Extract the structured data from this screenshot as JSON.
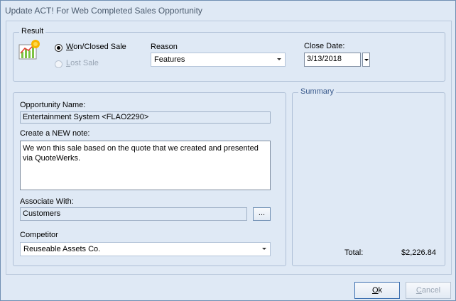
{
  "window": {
    "title": "Update ACT! For Web Completed Sales Opportunity"
  },
  "result": {
    "group_label": "Result",
    "icon": "sales-chart-icon",
    "won_label_underline": "W",
    "won_label_rest": "on/Closed Sale",
    "lost_label_underline": "L",
    "lost_label_rest": "ost Sale",
    "won_selected": true,
    "reason_label": "Reason",
    "reason_value": "Features",
    "close_date_label": "Close Date:",
    "close_date_value": "3/13/2018"
  },
  "details": {
    "opportunity_name_label": "Opportunity Name:",
    "opportunity_name_value": "Entertainment System <FLAO2290>",
    "note_label": "Create a NEW note:",
    "note_value": "We won this sale based on the quote that we created and presented via QuoteWerks.",
    "associate_label": "Associate With:",
    "associate_value": "Customers",
    "browse_label": "...",
    "competitor_label": "Competitor",
    "competitor_value": "Reuseable Assets Co."
  },
  "summary": {
    "group_label": "Summary",
    "total_label": "Total:",
    "total_value": "$2,226.84"
  },
  "buttons": {
    "ok_underline": "O",
    "ok_rest": "k",
    "cancel_underline": "C",
    "cancel_rest": "ancel"
  },
  "colors": {
    "title_text": "#4a5a6d",
    "summary_label": "#3a5a8c",
    "background": "#dfe9f5"
  }
}
